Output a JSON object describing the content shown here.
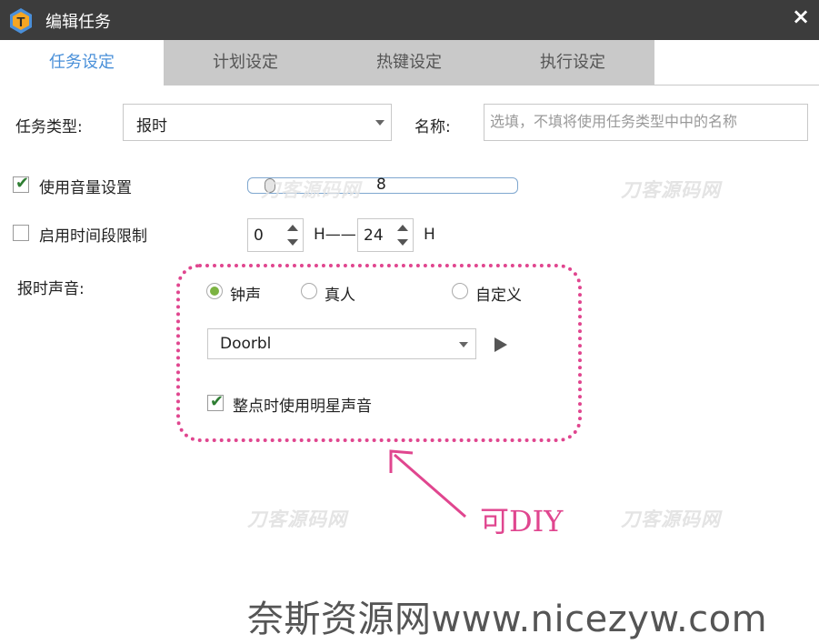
{
  "window": {
    "title": "编辑任务",
    "app_icon_letter": "T",
    "close_glyph": "×"
  },
  "tabs": [
    {
      "label": "任务设定",
      "active": true
    },
    {
      "label": "计划设定",
      "active": false
    },
    {
      "label": "热键设定",
      "active": false
    },
    {
      "label": "执行设定",
      "active": false
    }
  ],
  "form": {
    "task_type_label": "任务类型:",
    "task_type_value": "报时",
    "name_label": "名称:",
    "name_placeholder": "选填，不填将使用任务类型中中的名称",
    "use_volume_label": "使用音量设置",
    "use_volume_checked": true,
    "volume_value": "8",
    "time_limit_label": "启用时间段限制",
    "time_limit_checked": false,
    "time_start": "0",
    "time_start_unit": "H——",
    "time_end": "24",
    "time_end_unit": "H",
    "sound_label": "报时声音:",
    "sound_options": [
      {
        "label": "钟声",
        "selected": true
      },
      {
        "label": "真人",
        "selected": false
      },
      {
        "label": "自定义",
        "selected": false
      }
    ],
    "sound_file": "Doorbl",
    "star_voice_label": "整点时使用明星声音",
    "star_voice_checked": true
  },
  "annotation": "可DIY",
  "watermarks": [
    "刀客源码网",
    "刀客源码网",
    "刀客源码网",
    "刀客源码网"
  ],
  "footer_watermark": "奈斯资源网www.nicezyw.com",
  "colors": {
    "titlebar": "#3c3c3c",
    "active_tab_text": "#4a90d9",
    "inactive_tab_bg": "#c9c9c9",
    "annotation_pink": "#e0468f",
    "radio_selected": "#7cb342",
    "check_green": "#2e7d32"
  }
}
